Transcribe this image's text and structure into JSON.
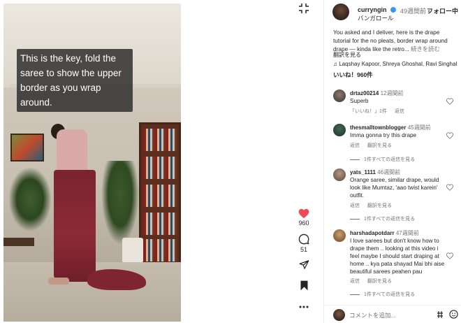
{
  "video": {
    "caption": "This is the key, fold the saree to show the upper border as you wrap around."
  },
  "actions": {
    "like_count": "960",
    "comment_count": "51",
    "icons": [
      "collapse-icon",
      "heart-icon",
      "comment-icon",
      "share-icon",
      "bookmark-icon",
      "more-icon"
    ],
    "like_color": "#ed4956"
  },
  "post": {
    "username": "curryngin",
    "time": "49週間前",
    "separator": "•",
    "follow_label": "フォロー中",
    "audio": "バンガロール",
    "description": "You asked and I deliver, here is the drape tutorial for the no pleats, border wrap around drape — kinda like the retro...",
    "more_label": "続きを読む",
    "translate_label": "翻訳を見る",
    "music": "Laqshay Kapoor, Shreya Ghoshal, Ravi Singhal · So...",
    "likes": "いいね！960件"
  },
  "comments": [
    {
      "username": "drtaz00214",
      "time": "12週間前",
      "text": "Superb",
      "meta": [
        "「いいね！」1件",
        "返信"
      ],
      "replies": ""
    },
    {
      "username": "thesmalltownblogger",
      "time": "45週間前",
      "text": "Imma gonna try this drape",
      "meta": [
        "返信",
        "翻訳を見る"
      ],
      "replies": "1件すべての返信を見る"
    },
    {
      "username": "yats_1111",
      "time": "46週間前",
      "text": "Orange saree, similar drape, would look like Mumtaz, 'aao twist karein' outfit.",
      "meta": [
        "返信",
        "翻訳を見る"
      ],
      "replies": "1件すべての返信を見る"
    },
    {
      "username": "harshadapotdarr",
      "time": "47週間前",
      "text": "I love sarees but don't know how to drape them .. looking at this video i feel maybe I should start draping at home .. kya pata shayad Mai bhi aise beautiful sarees peahen pau",
      "meta": [
        "返信",
        "翻訳を見る"
      ],
      "replies": "1件すべての返信を見る"
    }
  ],
  "footer": {
    "placeholder": "コメントを追加...",
    "icons": [
      "gif-icon",
      "emoji-icon"
    ]
  },
  "colors": {
    "verified": "#3897f0",
    "secondary_text": "#737373"
  }
}
